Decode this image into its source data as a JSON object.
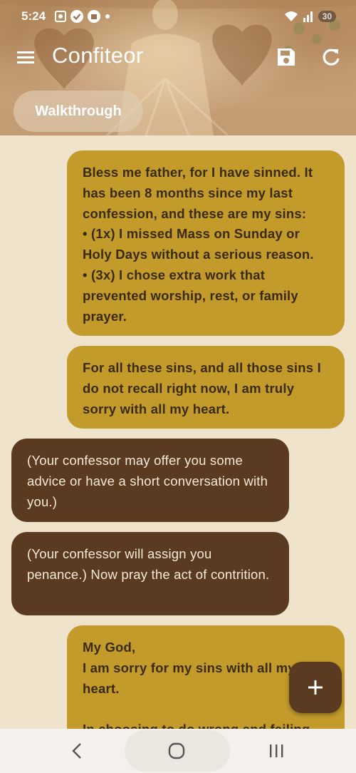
{
  "status_bar": {
    "time": "5:24",
    "battery": "30"
  },
  "app_bar": {
    "title": "Confiteor",
    "icons": [
      "menu-icon",
      "save-icon",
      "refresh-icon"
    ]
  },
  "walkthrough_label": "Walkthrough",
  "messages": [
    {
      "role": "user",
      "text": "Bless me father, for I have sinned. It has been 8 months since my last confession, and these are my sins:\n• (1x) I missed Mass on Sunday or Holy Days without a serious reason.\n• (3x) I chose extra work that prevented worship, rest, or family prayer."
    },
    {
      "role": "user",
      "text": "For all these sins, and all those sins I do not recall right now, I am truly sorry with all my heart."
    },
    {
      "role": "confessor",
      "text": "(Your confessor may offer you some advice or have a short conversation with you.)"
    },
    {
      "role": "confessor",
      "text": "(Your confessor will assign you penance.) Now pray the act of contrition."
    },
    {
      "role": "user",
      "text": "My God,\nI am sorry for my sins with all my heart.\n\nIn choosing to do wrong and failing"
    }
  ],
  "fab_icon": "plus-icon",
  "colors": {
    "user_bubble": "#c39b2a",
    "confessor_bubble": "#5a3a20",
    "background": "#efe3cc",
    "fab": "#5a3a20"
  },
  "nav_bar": {
    "icons": [
      "back-icon",
      "home-icon",
      "recents-icon"
    ]
  }
}
